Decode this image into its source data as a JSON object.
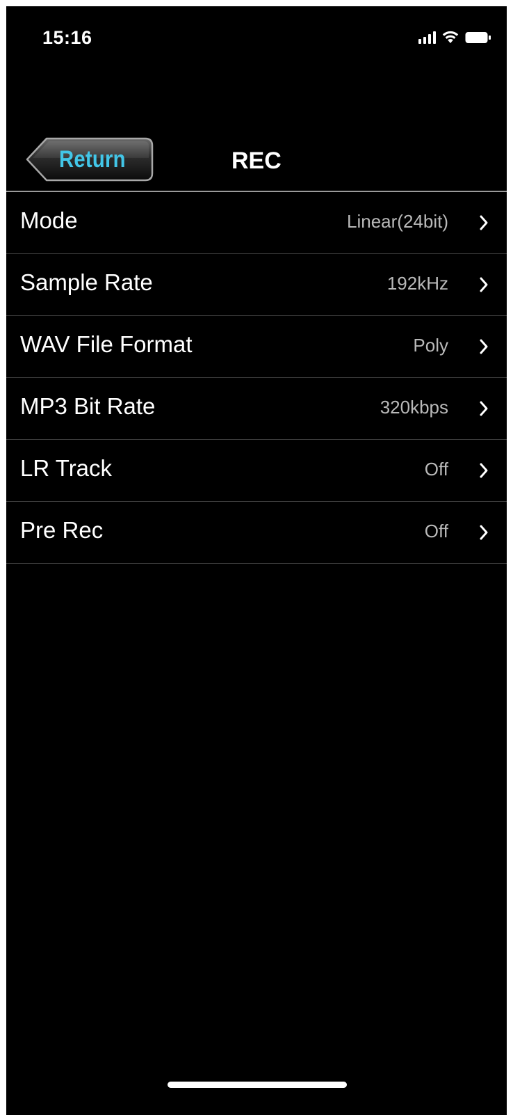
{
  "status_bar": {
    "time": "15:16",
    "icons": [
      "cellular-signal-icon",
      "wifi-icon",
      "battery-icon"
    ]
  },
  "nav": {
    "back_label": "Return",
    "title": "REC",
    "back_color": "#42c6e8"
  },
  "settings": [
    {
      "label": "Mode",
      "value": "Linear(24bit)"
    },
    {
      "label": "Sample Rate",
      "value": "192kHz"
    },
    {
      "label": "WAV File Format",
      "value": "Poly"
    },
    {
      "label": "MP3 Bit Rate",
      "value": "320kbps"
    },
    {
      "label": "LR Track",
      "value": "Off"
    },
    {
      "label": "Pre Rec",
      "value": "Off"
    }
  ],
  "colors": {
    "background": "#000000",
    "text": "#ffffff",
    "value_text": "#b9b9b9",
    "divider": "#3c3c3c"
  }
}
